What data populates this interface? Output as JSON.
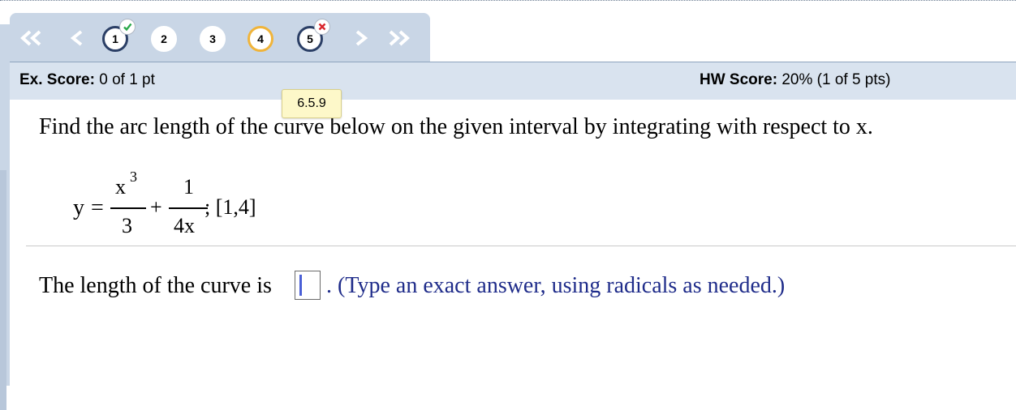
{
  "nav": {
    "first_icon": "double-chevron-left-icon",
    "prev_icon": "chevron-left-icon",
    "next_icon": "chevron-right-icon",
    "last_icon": "double-chevron-right-icon",
    "questions": [
      {
        "label": "1",
        "status": "correct"
      },
      {
        "label": "2",
        "status": "unanswered"
      },
      {
        "label": "3",
        "status": "unanswered"
      },
      {
        "label": "4",
        "status": "current"
      },
      {
        "label": "5",
        "status": "incorrect"
      }
    ]
  },
  "header": {
    "ex_score_label": "Ex. Score:",
    "ex_score_value": "0 of 1 pt",
    "hw_score_label": "HW Score:",
    "hw_score_value": "20% (1 of 5 pts)"
  },
  "tooltip": {
    "text": "6.5.9"
  },
  "problem": {
    "prompt": "Find the arc length of the curve below on the given interval by integrating with respect to x.",
    "equation": {
      "lhs": "y",
      "equals": "=",
      "term1_num": "x",
      "term1_exp": "3",
      "term1_den": "3",
      "plus": "+",
      "term2_num": "1",
      "term2_den": "4x",
      "interval": "; [1,4]"
    },
    "answer_prefix": "The length of the curve is",
    "answer_value": "",
    "answer_hint": ". (Type an exact answer, using radicals as needed.)"
  },
  "colors": {
    "tab_bg": "#c9d6e6",
    "header_bg": "#d9e3ef",
    "current_ring": "#f0b43a",
    "answered_ring": "#2b3f66",
    "correct_mark": "#2aa84a",
    "incorrect_mark": "#d9262c",
    "hint_text": "#1f2c8a"
  }
}
